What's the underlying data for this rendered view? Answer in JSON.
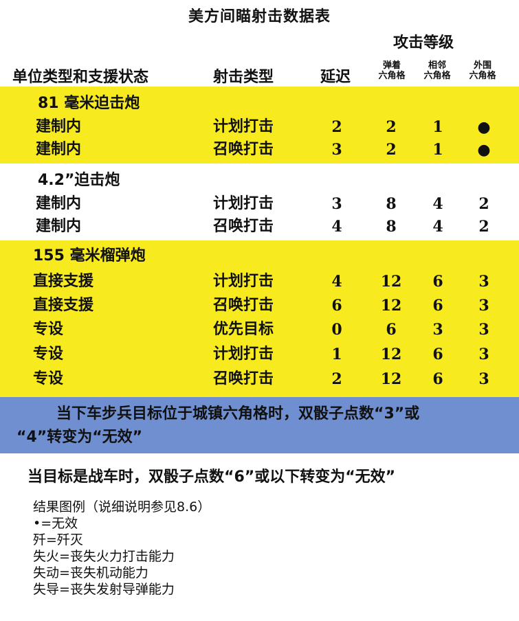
{
  "title": "美方间瞄射击数据表",
  "headers": {
    "attack_level": "攻击等级",
    "unit_status": "单位类型和支援状态",
    "fire_type": "射击类型",
    "delay": "延迟",
    "on_hex_1": "弹着",
    "on_hex_2": "六角格",
    "adj_hex_1": "相邻",
    "adj_hex_2": "六角格",
    "outer_hex_1": "外围",
    "outer_hex_2": "六角格"
  },
  "groups": [
    {
      "name": "81 毫米迫击炮",
      "rows": [
        {
          "unit": "建制内",
          "type": "计划打击",
          "delay": "2",
          "on": "2",
          "adj": "1",
          "out": "●"
        },
        {
          "unit": "建制内",
          "type": "召唤打击",
          "delay": "3",
          "on": "2",
          "adj": "1",
          "out": "●"
        }
      ]
    },
    {
      "name": "4.2”迫击炮",
      "rows": [
        {
          "unit": "建制内",
          "type": "计划打击",
          "delay": "3",
          "on": "8",
          "adj": "4",
          "out": "2"
        },
        {
          "unit": "建制内",
          "type": "召唤打击",
          "delay": "4",
          "on": "8",
          "adj": "4",
          "out": "2"
        }
      ]
    },
    {
      "name": "155 毫米榴弹炮",
      "rows": [
        {
          "unit": "直接支援",
          "type": "计划打击",
          "delay": "4",
          "on": "12",
          "adj": "6",
          "out": "3"
        },
        {
          "unit": "直接支援",
          "type": "召唤打击",
          "delay": "6",
          "on": "12",
          "adj": "6",
          "out": "3"
        },
        {
          "unit": "专设",
          "type": "优先目标",
          "delay": "0",
          "on": "6",
          "adj": "3",
          "out": "3"
        },
        {
          "unit": "专设",
          "type": "计划打击",
          "delay": "1",
          "on": "12",
          "adj": "6",
          "out": "3"
        },
        {
          "unit": "专设",
          "type": "召唤打击",
          "delay": "2",
          "on": "12",
          "adj": "6",
          "out": "3"
        }
      ]
    }
  ],
  "notes": {
    "blue_line1": "当下车步兵目标位于城镇六角格时，双骰子点数“3”或",
    "blue_line2": "“4”转变为“无效”",
    "vehicle": "当目标是战车时，双骰子点数“6”或以下转变为“无效”"
  },
  "legend": {
    "title": "结果图例（说细说明参见8.6）",
    "items": [
      "•=无效",
      "歼=歼灭",
      "失火=丧失火力打击能力",
      "失动=丧失机动能力",
      "失导=丧失发射导弹能力"
    ]
  },
  "colors": {
    "yellow_band": "#f7ea1f",
    "blue_band": "#6f8fd0"
  }
}
